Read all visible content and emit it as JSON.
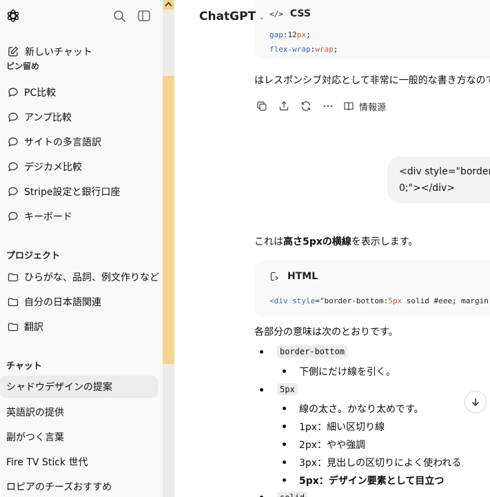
{
  "sidebar": {
    "new_chat": "新しいチャット",
    "cut_heading": "ピン留め",
    "pinned": [
      "PC比較",
      "アンプ比較",
      "サイトの多言語訳",
      "デジカメ比較",
      "Stripe設定と銀行口座",
      "キーボード"
    ],
    "projects_heading": "プロジェクト",
    "projects": [
      "ひらがな、品詞、例文作りなど",
      "自分の日本語関連",
      "翻訳"
    ],
    "chats_heading": "チャット",
    "chats": [
      "シャドウデザインの提案",
      "英語訳の提供",
      "副がつく言葉",
      "Fire TV Stick 世代",
      "ロピアのチーズおすすめ"
    ]
  },
  "header": {
    "model": "ChatGPT"
  },
  "conversation": {
    "code_top": {
      "lang": "CSS",
      "lines": [
        {
          "prop": "gap",
          "val": "12",
          "unit": "px"
        },
        {
          "prop": "flex-wrap",
          "val": "wrap",
          "unit": ""
        }
      ]
    },
    "para1": "はレスポンシブ対応として非常に一般的な書き方なので",
    "actions_source": "情報源",
    "user_line1": "<div style=\"border",
    "user_line2": "0;\"></div>",
    "para2_pre": "これは",
    "para2_bold": "高さ5pxの横線",
    "para2_post": "を表示します。",
    "code_html": {
      "lang": "HTML",
      "tag_open": "<div",
      "attr": "style",
      "str_pre": "=\"border-bottom:",
      "num": "5px",
      "str_post": " solid #eee; margin"
    },
    "para3": "各部分の意味は次のとおりです。",
    "items": [
      {
        "code": "border-bottom",
        "subs": [
          "下側にだけ線を引く。"
        ]
      },
      {
        "code": "5px",
        "subs": [
          "線の太さ。かなり太めです。",
          "1px：細い区切り線",
          "2px：やや強調",
          "3px：見出しの区切りによく使われる",
          "5px：デザイン要素として目立つ"
        ]
      }
    ],
    "item3_code": "solid"
  },
  "colors": {
    "sidebar_bg": "#f9f9f9",
    "active_item_bg": "#ececec",
    "scrollbar_thumb": "#f5d58c",
    "code_keyword": "#3b63c5",
    "code_unit": "#d2573f"
  }
}
